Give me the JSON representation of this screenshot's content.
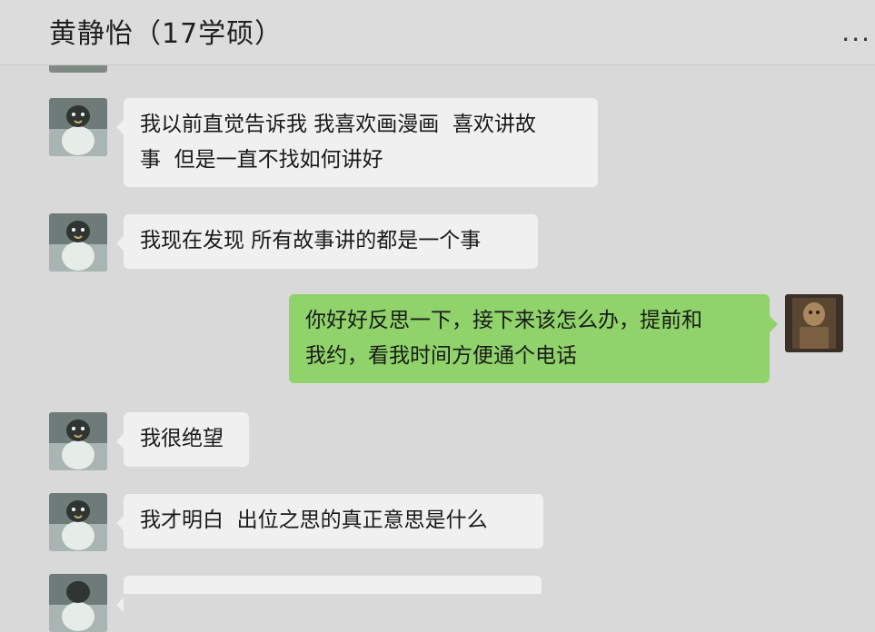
{
  "header": {
    "title": "黄静怡（17学硕）",
    "more_label": "..."
  },
  "messages": [
    {
      "side": "left",
      "text": "我以前直觉告诉我 我喜欢画漫画  喜欢讲故\n事  但是一直不找如何讲好"
    },
    {
      "side": "left",
      "text": "我现在发现 所有故事讲的都是一个事"
    },
    {
      "side": "right",
      "text": "你好好反思一下，接下来该怎么办，提前和\n我约，看我时间方便通个电话"
    },
    {
      "side": "left",
      "text": "我很绝望"
    },
    {
      "side": "left",
      "text": "我才明白  出位之思的真正意思是什么"
    }
  ],
  "colors": {
    "background": "#d9d9d9",
    "left_bubble": "#f0f0f0",
    "right_bubble": "#8fd36a"
  }
}
